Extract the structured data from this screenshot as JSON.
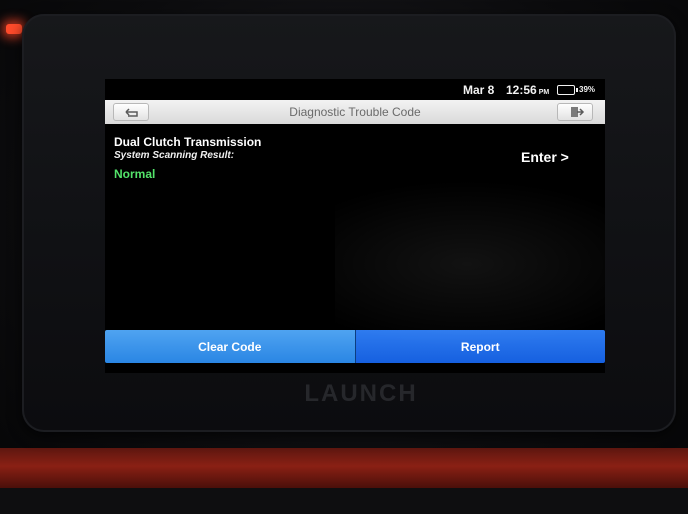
{
  "status_bar": {
    "date": "Mar 8",
    "time": "12:56",
    "ampm": "PM",
    "battery": "39%"
  },
  "title_bar": {
    "title": "Diagnostic Trouble Code",
    "back_icon": "back-arrow-icon",
    "exit_icon": "exit-door-icon"
  },
  "content": {
    "system_name": "Dual Clutch Transmission",
    "scan_label": "System Scanning Result:",
    "scan_status": "Normal",
    "enter_label": "Enter >"
  },
  "actions": {
    "clear_code": "Clear Code",
    "report": "Report"
  },
  "device": {
    "brand": "LAUNCH"
  },
  "colors": {
    "status_normal": "#53e36a",
    "button_left": "#2a86e4",
    "button_right": "#1660e0",
    "title_bar": "#e6e6e6"
  }
}
